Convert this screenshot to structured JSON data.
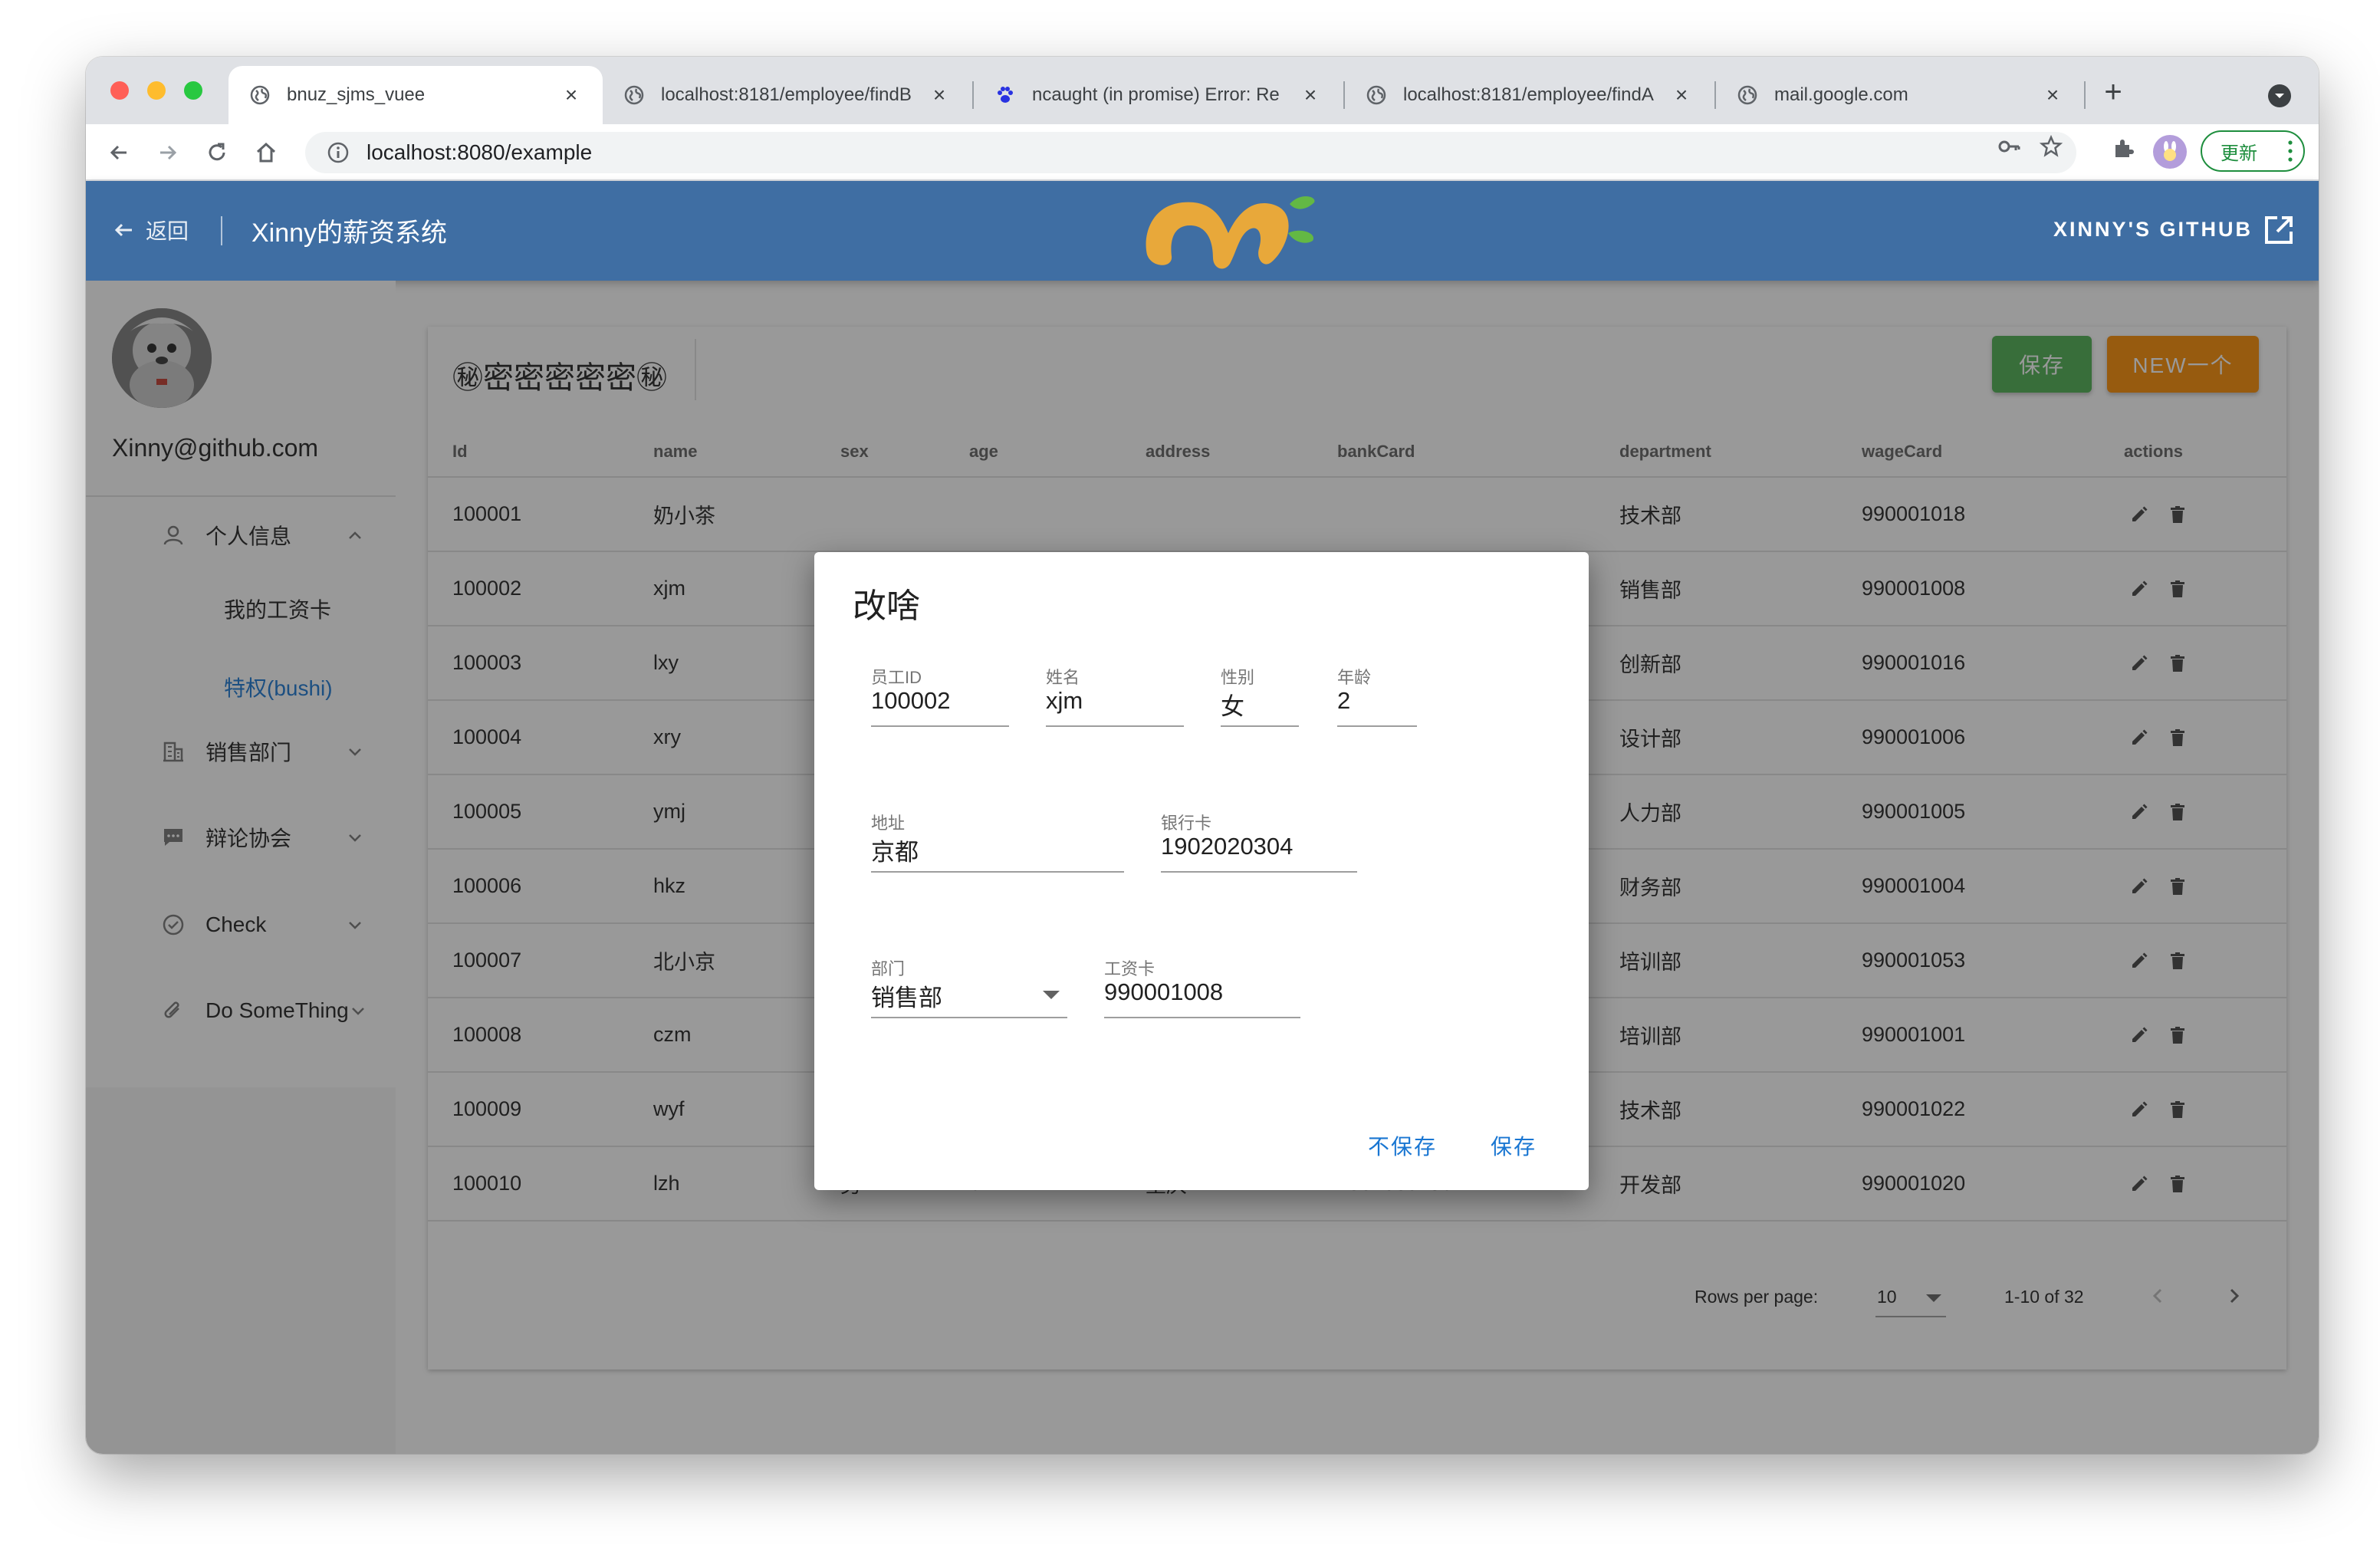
{
  "browser": {
    "tabs": [
      {
        "title": "bnuz_sjms_vuee",
        "close": "×"
      },
      {
        "title": "localhost:8181/employee/findB",
        "close": "×"
      },
      {
        "title": "ncaught (in promise) Error: Re",
        "close": "×"
      },
      {
        "title": "localhost:8181/employee/findA",
        "close": "×"
      },
      {
        "title": "mail.google.com",
        "close": "×"
      }
    ],
    "new_tab": "+",
    "url": "localhost:8080/example",
    "update_label": "更新"
  },
  "appbar": {
    "back_label": "返回",
    "title": "Xinny的薪资系统",
    "github_label": "XINNY'S GITHUB",
    "color": "#3f6ea3"
  },
  "sidebar": {
    "email": "Xinny@github.com",
    "groups": [
      {
        "label": "个人信息",
        "icon": "user-icon",
        "expanded": true
      },
      {
        "label": "销售部门",
        "icon": "building-icon"
      },
      {
        "label": "辩论协会",
        "icon": "chat-icon"
      },
      {
        "label": "Check",
        "icon": "check-circle-icon"
      },
      {
        "label": "Do SomeThing",
        "icon": "paperclip-icon"
      }
    ],
    "sub_items": [
      {
        "label": "我的工资卡"
      },
      {
        "label": "特权(bushi)",
        "active": true
      }
    ]
  },
  "card": {
    "title": "㊙密密密密密㊙",
    "save_label": "保存",
    "new_label": "NEW一个"
  },
  "table": {
    "headers": [
      "Id",
      "name",
      "sex",
      "age",
      "address",
      "bankCard",
      "department",
      "wageCard",
      "actions"
    ],
    "rows": [
      {
        "id": "100001",
        "name": "奶小茶",
        "sex": "",
        "age": "",
        "address": "",
        "bankCard": "",
        "department": "技术部",
        "wageCard": "990001018"
      },
      {
        "id": "100002",
        "name": "xjm",
        "sex": "",
        "age": "",
        "address": "",
        "bankCard": "",
        "department": "销售部",
        "wageCard": "990001008"
      },
      {
        "id": "100003",
        "name": "lxy",
        "sex": "",
        "age": "",
        "address": "",
        "bankCard": "",
        "department": "创新部",
        "wageCard": "990001016"
      },
      {
        "id": "100004",
        "name": "xry",
        "sex": "",
        "age": "",
        "address": "",
        "bankCard": "",
        "department": "设计部",
        "wageCard": "990001006"
      },
      {
        "id": "100005",
        "name": "ymj",
        "sex": "",
        "age": "",
        "address": "",
        "bankCard": "",
        "department": "人力部",
        "wageCard": "990001005"
      },
      {
        "id": "100006",
        "name": "hkz",
        "sex": "",
        "age": "",
        "address": "",
        "bankCard": "",
        "department": "财务部",
        "wageCard": "990001004"
      },
      {
        "id": "100007",
        "name": "北小京",
        "sex": "",
        "age": "",
        "address": "",
        "bankCard": "",
        "department": "培训部",
        "wageCard": "990001053"
      },
      {
        "id": "100008",
        "name": "czm",
        "sex": "",
        "age": "",
        "address": "",
        "bankCard": "",
        "department": "培训部",
        "wageCard": "990001001"
      },
      {
        "id": "100009",
        "name": "wyf",
        "sex": "",
        "age": "",
        "address": "",
        "bankCard": "",
        "department": "技术部",
        "wageCard": "990001022"
      },
      {
        "id": "100010",
        "name": "lzh",
        "sex": "男",
        "age": "6",
        "address": "重庆",
        "bankCard": "1901030486",
        "department": "开发部",
        "wageCard": "990001020"
      }
    ],
    "footer": {
      "rows_per_page_label": "Rows per page:",
      "rows_per_page_value": "10",
      "range": "1-10 of 32"
    }
  },
  "dialog": {
    "title": "改啥",
    "fields": {
      "employee_id": {
        "label": "员工ID",
        "value": "100002"
      },
      "name": {
        "label": "姓名",
        "value": "xjm"
      },
      "sex": {
        "label": "性别",
        "value": "女"
      },
      "age": {
        "label": "年龄",
        "value": "2"
      },
      "address": {
        "label": "地址",
        "value": "京都"
      },
      "bank_card": {
        "label": "银行卡",
        "value": "1902020304"
      },
      "department": {
        "label": "部门",
        "value": "销售部"
      },
      "wage_card": {
        "label": "工资卡",
        "value": "990001008"
      }
    },
    "cancel_label": "不保存",
    "save_label": "保存"
  }
}
